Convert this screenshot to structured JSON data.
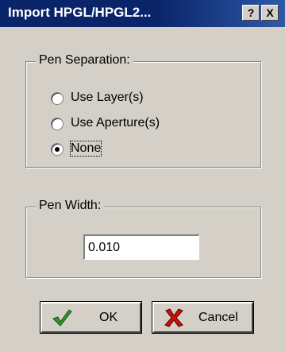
{
  "window": {
    "title": "Import HPGL/HPGL2...",
    "help_button": "?",
    "close_button": "X"
  },
  "pen_separation": {
    "label": "Pen Separation:",
    "options": [
      {
        "label": "Use Layer(s)",
        "selected": false
      },
      {
        "label": "Use Aperture(s)",
        "selected": false
      },
      {
        "label": "None",
        "selected": true
      }
    ]
  },
  "pen_width": {
    "label": "Pen Width:",
    "value": "0.010"
  },
  "buttons": {
    "ok_label": "OK",
    "cancel_label": "Cancel",
    "ok_icon": "green-check-icon",
    "cancel_icon": "red-x-icon"
  },
  "colors": {
    "titlebar": "#0a246a",
    "face": "#d4d0c8",
    "check": "#2e9a2e",
    "cross": "#c81010"
  }
}
